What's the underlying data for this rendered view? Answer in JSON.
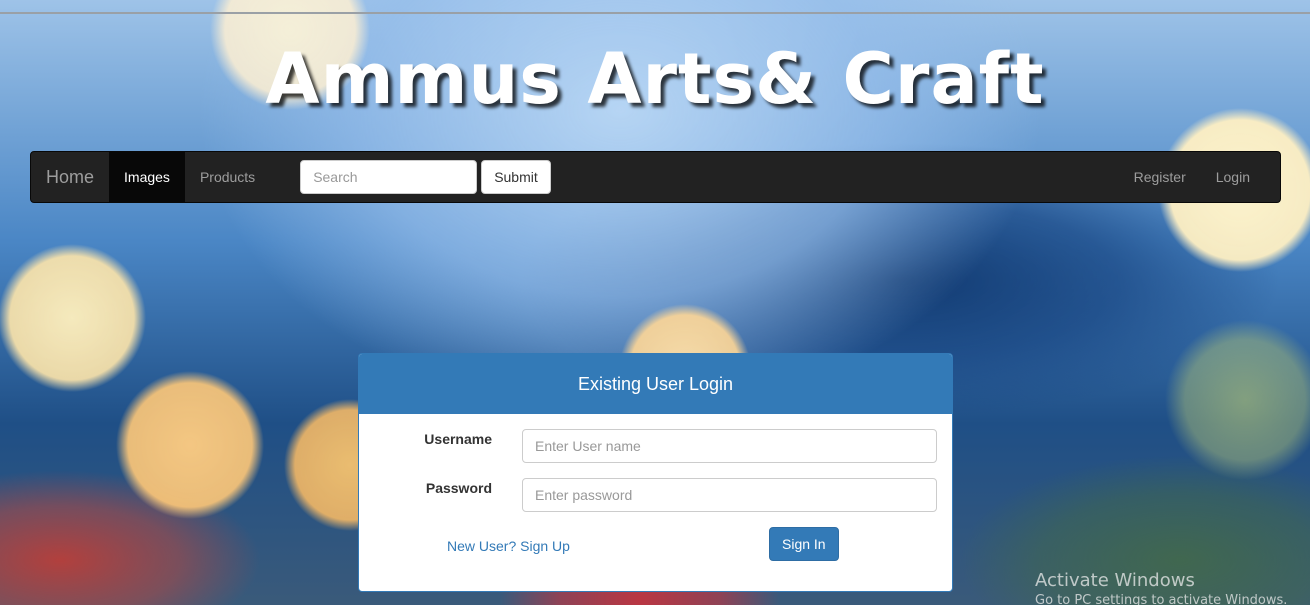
{
  "site": {
    "title": "Ammus Arts& Craft"
  },
  "navbar": {
    "brand": "Home",
    "items": [
      {
        "label": "Images",
        "active": true
      },
      {
        "label": "Products",
        "active": false
      }
    ],
    "search": {
      "placeholder": "Search",
      "value": "",
      "submit_label": "Submit"
    },
    "right_items": [
      {
        "label": "Register"
      },
      {
        "label": "Login"
      }
    ]
  },
  "login_panel": {
    "heading": "Existing User Login",
    "username": {
      "label": "Username",
      "placeholder": "Enter User name",
      "value": ""
    },
    "password": {
      "label": "Password",
      "placeholder": "Enter password",
      "value": ""
    },
    "signup_link": "New User? Sign Up",
    "signin_button": "Sign In"
  },
  "watermark": {
    "title": "Activate Windows",
    "subtitle": "Go to PC settings to activate Windows."
  },
  "colors": {
    "navbar_bg": "#222222",
    "primary": "#337ab7",
    "active_nav_bg": "#080808"
  }
}
